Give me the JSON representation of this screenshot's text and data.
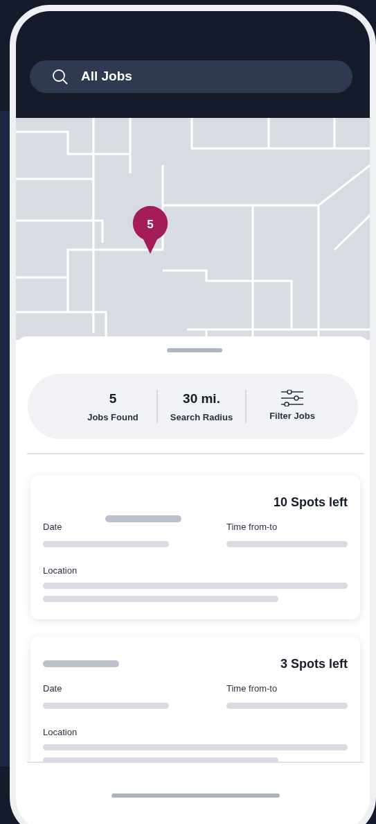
{
  "search": {
    "value": "All Jobs"
  },
  "map": {
    "pin": {
      "count": "5"
    }
  },
  "stats": [
    {
      "value": "5",
      "label": "Jobs Found"
    },
    {
      "value": "30 mi.",
      "label": "Search Radius"
    }
  ],
  "filter_button": {
    "label": "Filter Jobs"
  },
  "jobs": [
    {
      "spots": "10 Spots left",
      "date_label": "Date",
      "time_label": "Time from-to",
      "location_label": "Location"
    },
    {
      "spots": "3 Spots left",
      "date_label": "Date",
      "time_label": "Time from-to",
      "location_label": "Location"
    }
  ]
}
